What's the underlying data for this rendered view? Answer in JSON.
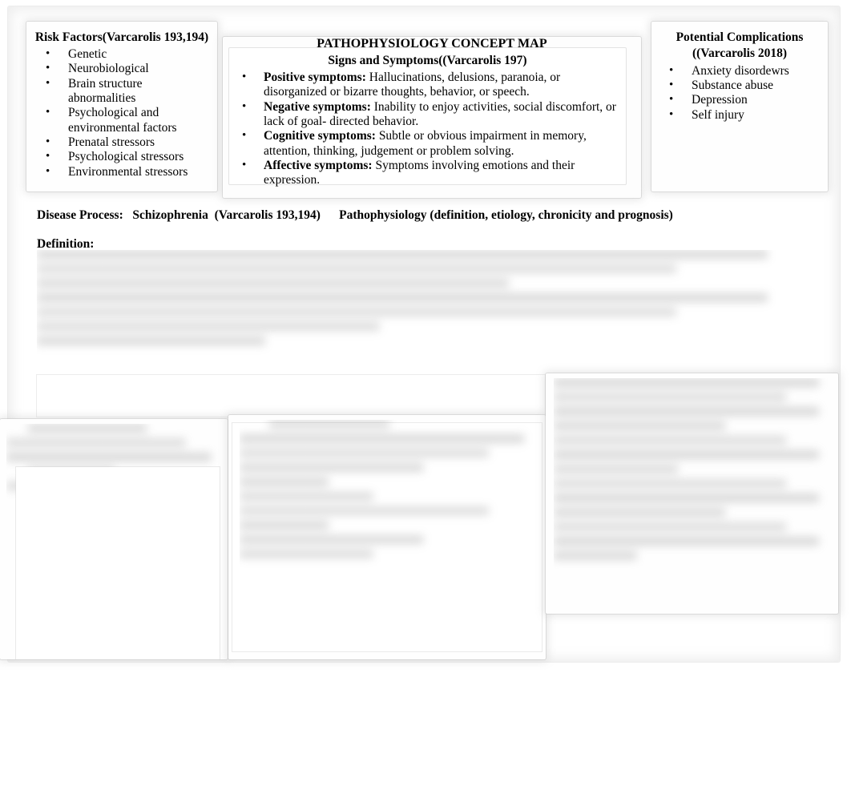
{
  "document": {
    "title": "PATHOPHYSIOLOGY CONCEPT MAP",
    "page_background": "#ffffff",
    "text_color": "#000000"
  },
  "risk_factors": {
    "title": "Risk Factors(Varcarolis 193,194)",
    "bullet_glyph": "•",
    "items": [
      "Genetic",
      "Neurobiological",
      "Brain structure abnormalities",
      "Psychological and environmental factors",
      "Prenatal stressors",
      "Psychological stressors",
      "Environmental stressors"
    ]
  },
  "signs_and_symptoms": {
    "title": "Signs and Symptoms((Varcarolis 197)",
    "bullet_glyph": "•",
    "items": [
      {
        "lead": "Positive symptoms:",
        "text": " Hallucinations, delusions, paranoia, or disorganized or bizarre thoughts, behavior, or speech."
      },
      {
        "lead": "Negative symptoms:",
        "text": " Inability to enjoy activities, social discomfort, or lack of goal- directed behavior."
      },
      {
        "lead": "Cognitive symptoms:",
        "text": " Subtle or obvious impairment in memory, attention, thinking, judgement or problem solving."
      },
      {
        "lead": "Affective symptoms:",
        "text": " Symptoms involving emotions and their expression."
      }
    ]
  },
  "potential_complications": {
    "title_line1": "Potential Complications",
    "title_line2": "((Varcarolis 2018)",
    "bullet_glyph": "•",
    "items": [
      "Anxiety disordewrs",
      "Substance abuse",
      "Depression",
      "Self injury"
    ]
  },
  "header_rows": {
    "disease_process": "Disease Process:   Schizophrenia  (Varcarolis 193,194)      Pathophysiology (definition, etiology, chronicity and prognosis)",
    "definition_label": "Definition:"
  },
  "redacted_regions": {
    "note": "illegible",
    "definition_body": "",
    "lower_left": "",
    "lower_center": "",
    "lower_right": ""
  }
}
